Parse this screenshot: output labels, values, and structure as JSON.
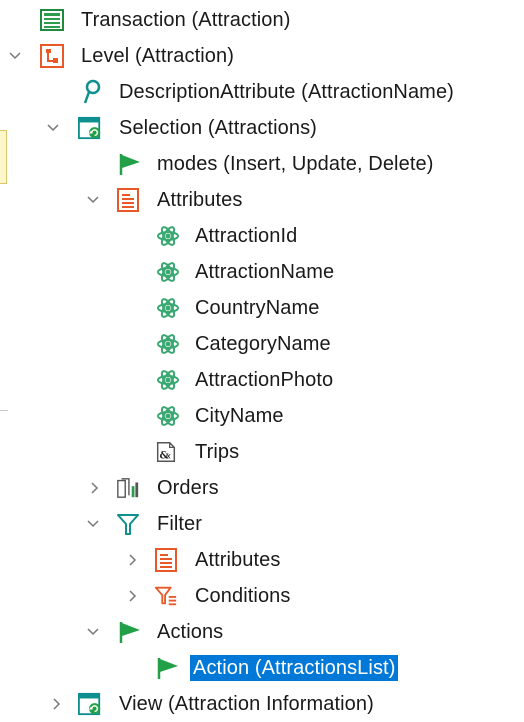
{
  "tree": {
    "transaction": "Transaction (Attraction)",
    "level": "Level (Attraction)",
    "description_attribute": "DescriptionAttribute (AttractionName)",
    "selection": "Selection (Attractions)",
    "modes": "modes (Insert, Update, Delete)",
    "attributes": "Attributes",
    "attribute_items": [
      "AttractionId",
      "AttractionName",
      "CountryName",
      "CategoryName",
      "AttractionPhoto",
      "CityName"
    ],
    "trips": "Trips",
    "orders": "Orders",
    "filter": "Filter",
    "filter_attributes": "Attributes",
    "conditions": "Conditions",
    "actions": "Actions",
    "action_selected": "Action (AttractionsList)",
    "view": "View (Attraction Information)"
  },
  "icons": {
    "transaction": "transaction-icon",
    "level": "level-icon",
    "description": "key-icon",
    "selection": "selection-icon",
    "modes": "flag-icon",
    "attributes": "attributes-icon",
    "attribute": "atom-icon",
    "trips": "trips-icon",
    "orders": "orders-icon",
    "filter": "filter-icon",
    "conditions": "conditions-icon",
    "actions": "flag-icon",
    "view": "view-icon"
  },
  "colors": {
    "selection_bg": "#0078d7",
    "green": "#21a047",
    "orange": "#e8592a",
    "teal": "#0f8f8f",
    "atom": "#39a872"
  }
}
